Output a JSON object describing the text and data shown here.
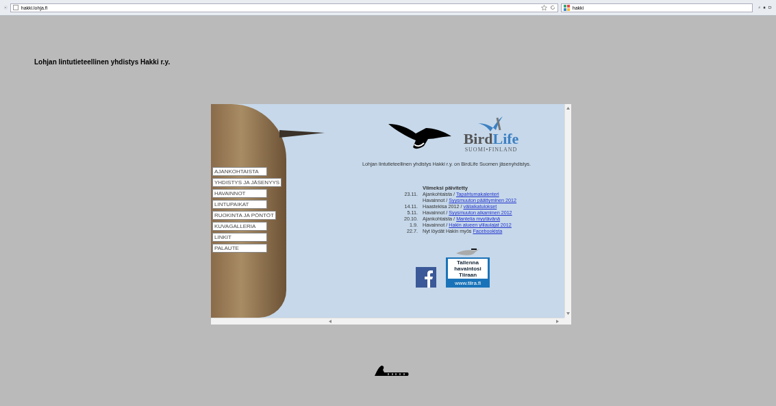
{
  "browser": {
    "address": "hakki.lohja.fi",
    "search": "hakki"
  },
  "page_title": "Lohjan lintutieteellinen yhdistys Hakki r.y.",
  "menu": [
    {
      "label": "AJANKOHTAISTA"
    },
    {
      "label": "YHDISTYS JA JÄSENYYS"
    },
    {
      "label": "HAVAINNOT"
    },
    {
      "label": "LINTUPAIKAT"
    },
    {
      "label": "RUOKINTA JA PÖNTÖT"
    },
    {
      "label": "KUVAGALLERIA"
    },
    {
      "label": "LINKIT"
    },
    {
      "label": "PALAUTE"
    }
  ],
  "birdlife": {
    "name_part1": "Bird",
    "name_part2": "Life",
    "subtitle": "SUOMI•FINLAND"
  },
  "intro": "Lohjan lintutieteellinen yhdistys Hakki r.y. on BirdLife Suomen jäsenyhdistys.",
  "updates": {
    "heading": "Viimeksi päivitetty",
    "rows": [
      {
        "date": "23.11.",
        "text": "Ajankohtaista / ",
        "link": "Tapahtumakalenteri"
      },
      {
        "date": "",
        "text": "Havainnot / ",
        "link": "Syysmuuton päättyminen 2012"
      },
      {
        "date": "14.11.",
        "text": "Haastekisa 2012 / ",
        "link": "väliaikatulokset"
      },
      {
        "date": "5.11.",
        "text": "Havainnot / ",
        "link": "Syysmuuton alkaminen 2012"
      },
      {
        "date": "20.10.",
        "text": "Ajankohtaista / ",
        "link": "Mantelia myytävänä"
      },
      {
        "date": "1.9.",
        "text": "Havainnot / ",
        "link": "Hakin alueen ylilaulajat 2012"
      },
      {
        "date": "22.7.",
        "text": "Nyt löydät Hakin myös ",
        "link": "Facebookista"
      }
    ]
  },
  "tiira": {
    "caption": "Tallenna havaintosi Tiiraan",
    "url": "www.tiira.fi"
  }
}
